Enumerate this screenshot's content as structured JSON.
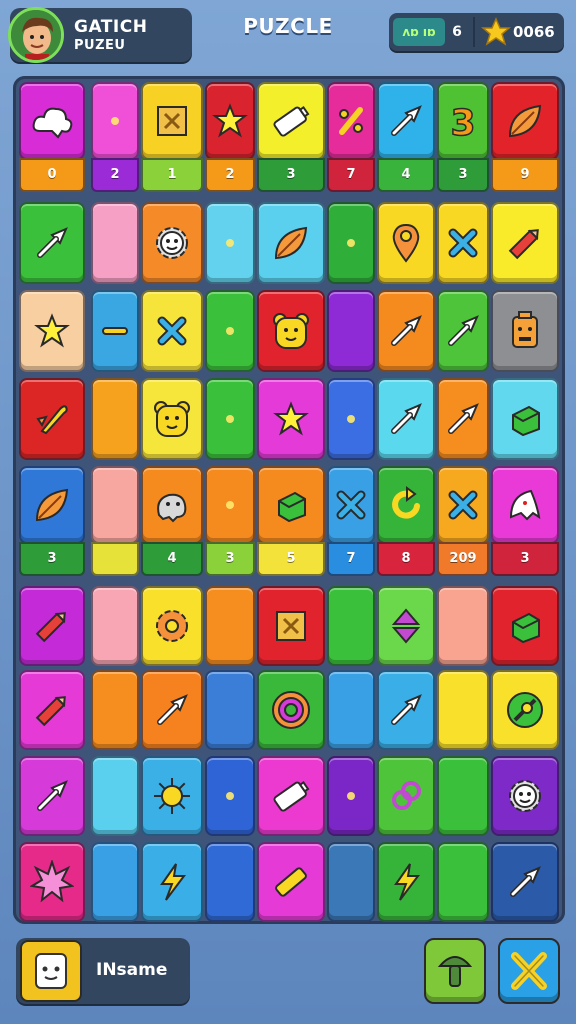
{
  "header": {
    "player_name": "GATICH",
    "player_sub": "PUZEU",
    "title": "PUZCLE",
    "moves": "ʌɒ ıɒ",
    "level": "6",
    "score": "0066"
  },
  "board": {
    "columns": 9,
    "row_a_badges": [
      "0",
      "2",
      "1",
      "2",
      "3",
      "7",
      "4",
      "3",
      "9"
    ],
    "row_b_badges": [
      "3",
      "",
      "4",
      "3",
      "5",
      "7",
      "8",
      "209",
      "3"
    ],
    "badge_colors_a": [
      "#f59a18",
      "#9a2bd6",
      "#8bd23a",
      "#f59a18",
      "#2f9c3a",
      "#d0243c",
      "#3ab33c",
      "#2f9c3a",
      "#f59a18"
    ],
    "badge_colors_b": [
      "#2f9c3a",
      "#e6e23a",
      "#2f9c3a",
      "#8bd23a",
      "#f2e23a",
      "#2a8ee0",
      "#d9243e",
      "#f07a2a",
      "#d0243c"
    ],
    "rows": [
      [
        {
          "c": "#d82cd6",
          "i": "cloud-icon"
        },
        {
          "c": "#f04fd8",
          "i": "dot-icon"
        },
        {
          "c": "#f7d224",
          "i": "box-icon"
        },
        {
          "c": "#d9232e",
          "i": "star-icon"
        },
        {
          "c": "#f3ef2a",
          "i": "battery-icon"
        },
        {
          "c": "#e52c9a",
          "i": "percent-icon"
        },
        {
          "c": "#2fb2ea",
          "i": "arrow-icon"
        },
        {
          "c": "#4fc234",
          "i": "number-three-icon"
        },
        {
          "c": "#e3232a",
          "i": "leaf-icon"
        }
      ],
      [
        {
          "c": "#3ac03a",
          "i": "arrow-icon"
        },
        {
          "c": "#f6a0c6",
          "i": ""
        },
        {
          "c": "#f58a28",
          "i": "gear-face-icon"
        },
        {
          "c": "#62d2ee",
          "i": "dot-icon"
        },
        {
          "c": "#5ad0ee",
          "i": "leaf-icon"
        },
        {
          "c": "#2fae3a",
          "i": "dot-icon"
        },
        {
          "c": "#f9d823",
          "i": "pin-icon"
        },
        {
          "c": "#f9d823",
          "i": "cross-icon"
        },
        {
          "c": "#f9ea2a",
          "i": "pencil-icon"
        }
      ],
      [
        {
          "c": "#f8cfa0",
          "i": "star-icon"
        },
        {
          "c": "#3aa6e2",
          "i": "dash-icon"
        },
        {
          "c": "#f7e43a",
          "i": "cross-icon"
        },
        {
          "c": "#3ac03a",
          "i": "dot-icon"
        },
        {
          "c": "#e0232c",
          "i": "bear-face-icon"
        },
        {
          "c": "#8e2ad6",
          "i": ""
        },
        {
          "c": "#f58a1f",
          "i": "arrow-icon"
        },
        {
          "c": "#4dc43a",
          "i": "arrow-icon"
        },
        {
          "c": "#8d8f93",
          "i": "robot-face-icon"
        }
      ],
      [
        {
          "c": "#dc2626",
          "i": "rocket-icon"
        },
        {
          "c": "#f6a21f",
          "i": ""
        },
        {
          "c": "#f6e53a",
          "i": "bear-face-icon"
        },
        {
          "c": "#3ac03a",
          "i": "dot-icon"
        },
        {
          "c": "#e43ad8",
          "i": "star-icon"
        },
        {
          "c": "#3b6ee2",
          "i": "dot-icon"
        },
        {
          "c": "#5ad8ee",
          "i": "arrow-icon"
        },
        {
          "c": "#f68e1f",
          "i": "arrow-icon"
        },
        {
          "c": "#62d8ee",
          "i": "cube-icon"
        }
      ],
      [
        {
          "c": "#2f78d8",
          "i": "leaf-icon"
        },
        {
          "c": "#f8a6a0",
          "i": ""
        },
        {
          "c": "#f58a1f",
          "i": "elephant-icon"
        },
        {
          "c": "#f58a1f",
          "i": "dot-icon"
        },
        {
          "c": "#f58a1f",
          "i": "cube-icon"
        },
        {
          "c": "#3aa0e6",
          "i": "cross-icon"
        },
        {
          "c": "#36b43a",
          "i": "refresh-icon"
        },
        {
          "c": "#f6a81f",
          "i": "cross-icon"
        },
        {
          "c": "#e93ad8",
          "i": "ghost-icon"
        }
      ],
      [
        {
          "c": "#c52ad8",
          "i": "pencil-icon"
        },
        {
          "c": "#f8a6b4",
          "i": ""
        },
        {
          "c": "#f9e02a",
          "i": "gear-icon"
        },
        {
          "c": "#f68e1f",
          "i": ""
        },
        {
          "c": "#e0232c",
          "i": "box-icon"
        },
        {
          "c": "#3ac03a",
          "i": ""
        },
        {
          "c": "#6ad84a",
          "i": "up-down-icon"
        },
        {
          "c": "#f8a490",
          "i": ""
        },
        {
          "c": "#e0232c",
          "i": "cube-icon"
        }
      ],
      [
        {
          "c": "#e53ad6",
          "i": "pencil-icon"
        },
        {
          "c": "#f68e1f",
          "i": ""
        },
        {
          "c": "#f6821f",
          "i": "arrow-icon"
        },
        {
          "c": "#3a7ed8",
          "i": ""
        },
        {
          "c": "#3ab83a",
          "i": "target-icon"
        },
        {
          "c": "#3aa0e6",
          "i": ""
        },
        {
          "c": "#3aaee6",
          "i": "arrow-icon"
        },
        {
          "c": "#f9e02a",
          "i": ""
        },
        {
          "c": "#f9e02a",
          "i": "globe-icon"
        }
      ],
      [
        {
          "c": "#d63ad8",
          "i": "arrow-icon"
        },
        {
          "c": "#5ad0ee",
          "i": ""
        },
        {
          "c": "#3ab0e6",
          "i": "sun-icon"
        },
        {
          "c": "#2f64d6",
          "i": "dot-icon"
        },
        {
          "c": "#ec3ad0",
          "i": "battery-icon"
        },
        {
          "c": "#7b26c6",
          "i": "dot-icon"
        },
        {
          "c": "#4dc43a",
          "i": "link-icon"
        },
        {
          "c": "#3ac03a",
          "i": ""
        },
        {
          "c": "#7d2ac8",
          "i": "gear-face-icon"
        }
      ],
      [
        {
          "c": "#e52a8a",
          "i": "burst-icon"
        },
        {
          "c": "#3aa0e6",
          "i": ""
        },
        {
          "c": "#3aaee6",
          "i": "lightning-icon"
        },
        {
          "c": "#2f6ad6",
          "i": ""
        },
        {
          "c": "#e53ad6",
          "i": "bar-icon"
        },
        {
          "c": "#3a78b8",
          "i": ""
        },
        {
          "c": "#36b43a",
          "i": "lightning-icon"
        },
        {
          "c": "#3ac03a",
          "i": ""
        },
        {
          "c": "#2a5aa8",
          "i": "arrow-icon"
        }
      ]
    ]
  },
  "footer": {
    "profile_name": "INsame"
  }
}
